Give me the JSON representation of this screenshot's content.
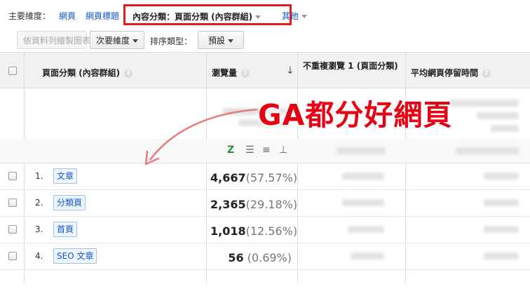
{
  "dimension_bar": {
    "label": "主要維度：",
    "links": [
      "網頁",
      "網頁標題"
    ],
    "active": "內容分類：頁面分類 (內容群組)",
    "other": "其他"
  },
  "toolbar": {
    "plot_rows_button": "依資料列繪製圖表",
    "secondary_dimension": "次要維度",
    "sort_type_label": "排序類型：",
    "sort_type_value": "預設"
  },
  "table": {
    "headers": {
      "dimension": "頁面分類 (內容群組)",
      "pageviews": "瀏覽量",
      "unique_pageviews": "不重複瀏覽 1 (頁面分類)",
      "avg_time": "平均網頁停留時間"
    },
    "rows": [
      {
        "num": "1.",
        "label": "文章",
        "value": "4,667",
        "pct": "(57.57%)"
      },
      {
        "num": "2.",
        "label": "分類頁",
        "value": "2,365",
        "pct": "(29.18%)"
      },
      {
        "num": "3.",
        "label": "首頁",
        "value": "1,018",
        "pct": "(12.56%)"
      },
      {
        "num": "4.",
        "label": "SEO 文章",
        "value": "56",
        "pct": "(0.69%)"
      }
    ]
  },
  "annotation": {
    "text": "GA都分好網頁",
    "color": "#e60012"
  },
  "colors": {
    "link": "#1155cc",
    "highlight_border": "#e31c1c"
  }
}
